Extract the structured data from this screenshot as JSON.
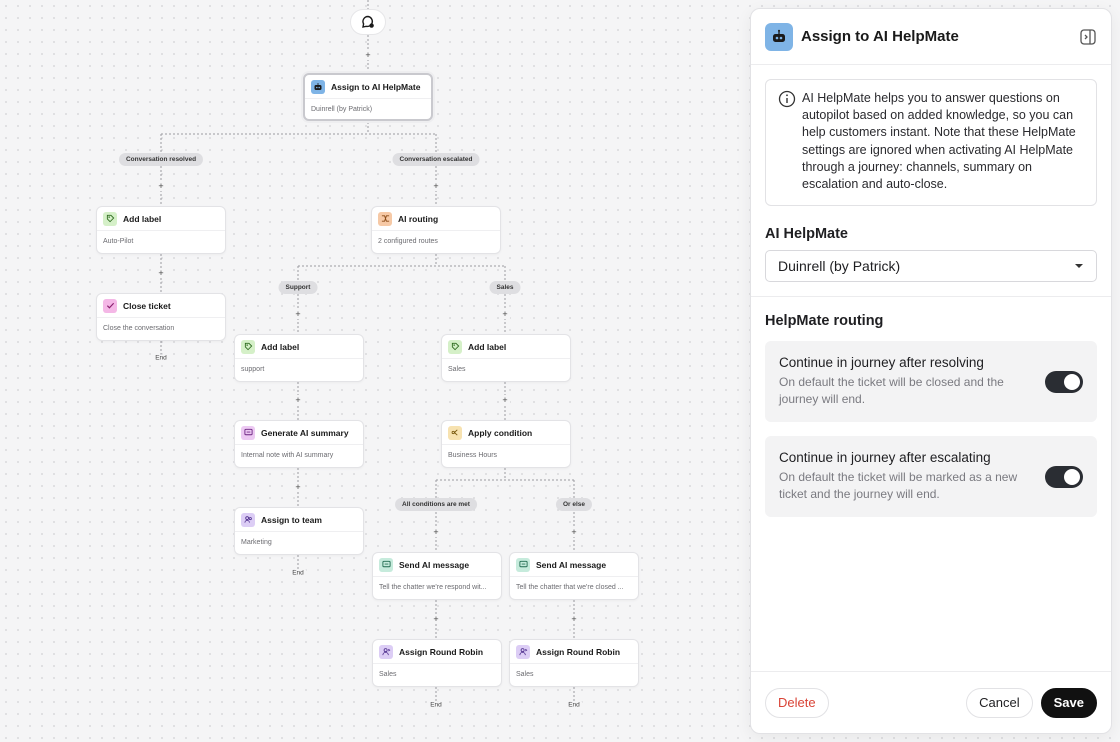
{
  "canvas": {
    "selected_node": {
      "title": "Assign to AI HelpMate",
      "subtitle": "Duinrell (by Patrick)"
    },
    "branches": {
      "resolved_label": "Conversation resolved",
      "escalated_label": "Conversation escalated",
      "support_label": "Support",
      "sales_label": "Sales",
      "conditions_met_label": "All conditions are met",
      "else_label": "Or else"
    },
    "nodes": {
      "add_label_autopilot": {
        "title": "Add label",
        "subtitle": "Auto-Pilot"
      },
      "ai_routing": {
        "title": "AI routing",
        "subtitle": "2 configured routes"
      },
      "close_ticket": {
        "title": "Close ticket",
        "subtitle": "Close the conversation"
      },
      "add_label_support": {
        "title": "Add label",
        "subtitle": "support"
      },
      "add_label_sales": {
        "title": "Add label",
        "subtitle": "Sales"
      },
      "generate_summary": {
        "title": "Generate AI summary",
        "subtitle": "Internal note with AI summary"
      },
      "apply_condition": {
        "title": "Apply condition",
        "subtitle": "Business Hours"
      },
      "assign_team": {
        "title": "Assign to team",
        "subtitle": "Marketing"
      },
      "send_ai_message_1": {
        "title": "Send AI message",
        "subtitle": "Tell the chatter we're respond wit..."
      },
      "send_ai_message_2": {
        "title": "Send AI message",
        "subtitle": "Tell the chatter that we're closed ..."
      },
      "round_robin_1": {
        "title": "Assign Round Robin",
        "subtitle": "Sales"
      },
      "round_robin_2": {
        "title": "Assign Round Robin",
        "subtitle": "Sales"
      }
    },
    "plus_symbol": "+",
    "end_label": "End"
  },
  "panel": {
    "title": "Assign to AI HelpMate",
    "info_text": "AI HelpMate helps you to answer questions on autopilot based on added knowledge, so you can help customers instant. Note that these HelpMate settings are ignored when activating AI HelpMate through a journey: channels, summary on escalation and auto-close.",
    "helpmate_label": "AI HelpMate",
    "helpmate_value": "Duinrell (by Patrick)",
    "routing_label": "HelpMate routing",
    "toggles": [
      {
        "title": "Continue in journey after resolving",
        "description": "On default the ticket will be closed and the journey will end.",
        "on": true
      },
      {
        "title": "Continue in journey after escalating",
        "description": "On default the ticket will be marked as a new ticket and the journey will end.",
        "on": true
      }
    ],
    "buttons": {
      "delete": "Delete",
      "cancel": "Cancel",
      "save": "Save"
    }
  },
  "colors": {
    "label_icon_bg": "#d5f0c8",
    "routing_icon_bg": "#f6c9a6",
    "close_icon_bg": "#f4b7e6",
    "summary_icon_bg": "#ecc9f2",
    "condition_icon_bg": "#f7e2b0",
    "message_icon_bg": "#c6ebdc",
    "team_icon_bg": "#dccdf5",
    "robot_bg": "#7fb4e6",
    "delete_text": "#d94336",
    "toggle_on": "#2a2d33"
  }
}
